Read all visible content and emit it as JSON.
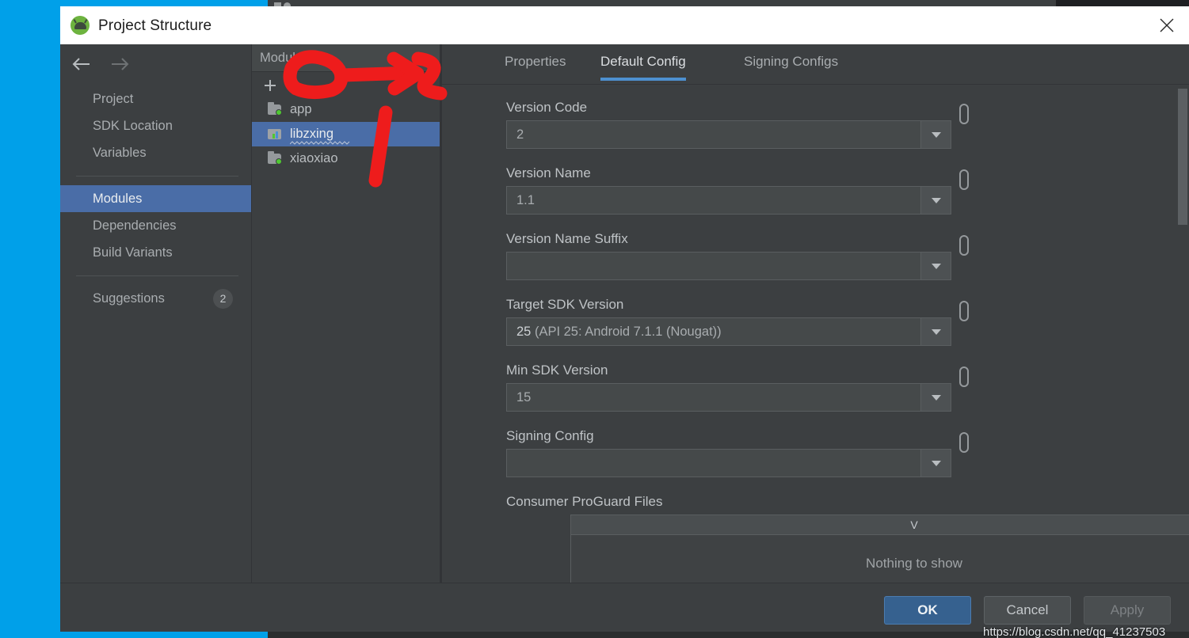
{
  "window": {
    "title": "Project Structure",
    "app_icon": "android-studio-icon",
    "close_icon": "close-icon"
  },
  "nav": {
    "back_icon": "arrow-left-icon",
    "forward_icon": "arrow-right-icon",
    "groups": [
      {
        "items": [
          {
            "label": "Project",
            "active": false
          },
          {
            "label": "SDK Location",
            "active": false
          },
          {
            "label": "Variables",
            "active": false
          }
        ]
      },
      {
        "items": [
          {
            "label": "Modules",
            "active": true
          },
          {
            "label": "Dependencies",
            "active": false
          },
          {
            "label": "Build Variants",
            "active": false
          }
        ]
      },
      {
        "items": [
          {
            "label": "Suggestions",
            "active": false,
            "badge": "2"
          }
        ]
      }
    ]
  },
  "modules_panel": {
    "title": "Modules",
    "collapse_icon": "minimize-icon",
    "add_icon": "plus-icon",
    "remove_icon": "minus-icon",
    "items": [
      {
        "label": "app",
        "icon": "module-folder-icon",
        "selected": false
      },
      {
        "label": "libzxing",
        "icon": "library-module-icon",
        "selected": true
      },
      {
        "label": "xiaoxiao",
        "icon": "module-folder-icon",
        "selected": false
      }
    ]
  },
  "tabs": [
    {
      "label": "Properties",
      "active": false
    },
    {
      "label": "Default Config",
      "active": true
    },
    {
      "label": "Signing Configs",
      "active": false
    }
  ],
  "fields": [
    {
      "label": "Version Code",
      "value": "2",
      "highlight": "",
      "rest": ""
    },
    {
      "label": "Version Name",
      "value": "1.1",
      "highlight": "",
      "rest": ""
    },
    {
      "label": "Version Name Suffix",
      "value": "",
      "highlight": "",
      "rest": ""
    },
    {
      "label": "Target SDK Version",
      "value": "",
      "highlight": "25",
      "rest": " (API 25: Android 7.1.1 (Nougat))"
    },
    {
      "label": "Min SDK Version",
      "value": "15",
      "highlight": "",
      "rest": ""
    },
    {
      "label": "Signing Config",
      "value": "",
      "highlight": "",
      "rest": ""
    }
  ],
  "variable_icon": "variable-braces-icon",
  "dropdown_icon": "chevron-down-icon",
  "table": {
    "label": "Consumer ProGuard Files",
    "column_header": "V",
    "empty_message": "Nothing to show",
    "add_icon": "plus-icon",
    "remove_icon": "minus-icon"
  },
  "footer": {
    "ok_label": "OK",
    "cancel_label": "Cancel",
    "apply_label": "Apply",
    "watermark": "https://blog.csdn.net/qq_41237503"
  },
  "colors": {
    "accent_blue": "#4a6da7",
    "tab_underline": "#4d90d0",
    "ok_button": "#36618f",
    "annotation_red": "#ee1c1c",
    "desktop_blue": "#00a0e9",
    "panel_bg": "#3c3f41",
    "field_bg": "#45494a"
  }
}
